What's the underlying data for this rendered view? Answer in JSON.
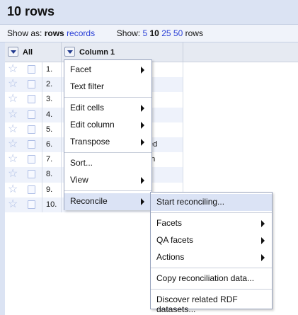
{
  "header": {
    "title": "10 rows"
  },
  "show_bar": {
    "show_as_label": "Show as:",
    "rows_label": "rows",
    "records_label": "records",
    "show_label": "Show:",
    "page_sizes": [
      "5",
      "10",
      "25",
      "50"
    ],
    "page_sizes_suffix": "rows",
    "selected_page_size": "10"
  },
  "grid": {
    "all_column": "All",
    "column1": "Column 1",
    "rows": [
      {
        "num": "1.",
        "tail": ""
      },
      {
        "num": "2.",
        "tail": ""
      },
      {
        "num": "3.",
        "tail": ""
      },
      {
        "num": "4.",
        "tail": ""
      },
      {
        "num": "5.",
        "tail": ""
      },
      {
        "num": "6.",
        "tail": "ted"
      },
      {
        "num": "7.",
        "tail": "on"
      },
      {
        "num": "8.",
        "tail": ""
      },
      {
        "num": "9.",
        "tail": ""
      },
      {
        "num": "10.",
        "tail": ""
      }
    ]
  },
  "column_menu": {
    "facet": "Facet",
    "text_filter": "Text filter",
    "edit_cells": "Edit cells",
    "edit_column": "Edit column",
    "transpose": "Transpose",
    "sort": "Sort...",
    "view": "View",
    "reconcile": "Reconcile"
  },
  "reconcile_menu": {
    "start_reconciling": "Start reconciling...",
    "facets": "Facets",
    "qa_facets": "QA facets",
    "actions": "Actions",
    "copy_data": "Copy reconciliation data...",
    "discover_rdf": "Discover related RDF datasets..."
  },
  "colors": {
    "accent_link": "#2a3fd6",
    "menu_highlight": "#dbe3f5"
  }
}
